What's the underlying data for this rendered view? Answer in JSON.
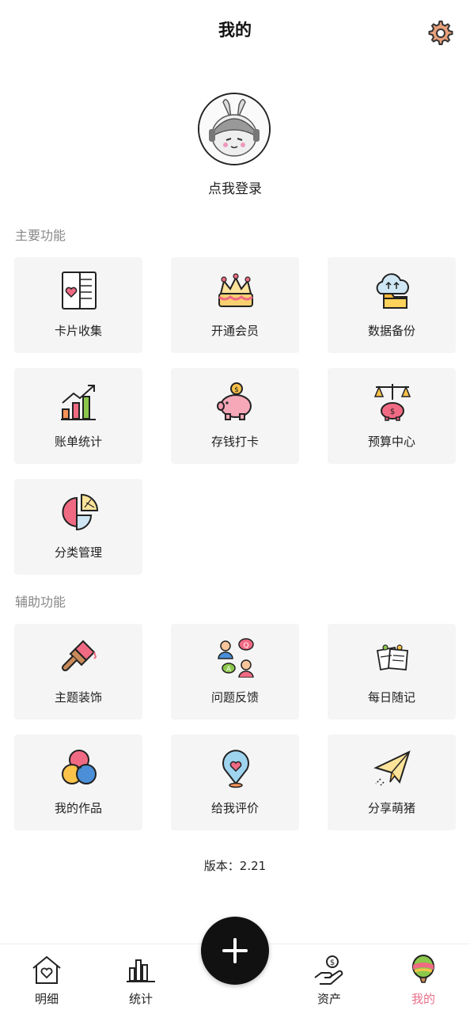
{
  "header": {
    "title": "我的",
    "settings_icon": "gear-icon"
  },
  "profile": {
    "avatar_icon": "avatar-icon",
    "login_label": "点我登录"
  },
  "main_section": {
    "title": "主要功能",
    "items": [
      {
        "label": "卡片收集",
        "icon": "card-book-icon"
      },
      {
        "label": "开通会员",
        "icon": "crown-cake-icon"
      },
      {
        "label": "数据备份",
        "icon": "cloud-folder-icon"
      },
      {
        "label": "账单统计",
        "icon": "bar-chart-icon"
      },
      {
        "label": "存钱打卡",
        "icon": "piggy-bank-icon"
      },
      {
        "label": "预算中心",
        "icon": "scale-piggy-icon"
      },
      {
        "label": "分类管理",
        "icon": "pie-chart-icon"
      }
    ]
  },
  "aux_section": {
    "title": "辅助功能",
    "items": [
      {
        "label": "主题装饰",
        "icon": "paint-brush-icon"
      },
      {
        "label": "问题反馈",
        "icon": "feedback-icon"
      },
      {
        "label": "每日随记",
        "icon": "notes-icon"
      },
      {
        "label": "我的作品",
        "icon": "color-circles-icon"
      },
      {
        "label": "给我评价",
        "icon": "heart-pin-icon"
      },
      {
        "label": "分享萌猪",
        "icon": "paper-plane-icon"
      }
    ]
  },
  "version": {
    "text": "版本：2.21"
  },
  "bottom_nav": {
    "items": [
      {
        "label": "明细",
        "icon": "house-heart-icon"
      },
      {
        "label": "统计",
        "icon": "bar-stats-icon"
      },
      {
        "label": "资产",
        "icon": "hand-coin-icon"
      },
      {
        "label": "我的",
        "icon": "balloon-icon",
        "active": true
      }
    ],
    "add_icon": "plus-icon"
  },
  "colors": {
    "accent": "#e8708a",
    "card_bg": "#f5f5f5",
    "fab": "#111111"
  }
}
